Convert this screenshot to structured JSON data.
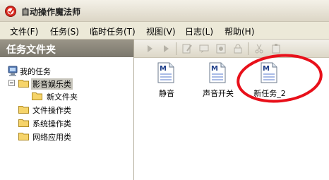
{
  "window": {
    "title": "自动操作魔法师"
  },
  "menu": [
    {
      "label": "文件(F)"
    },
    {
      "label": "任务(S)"
    },
    {
      "label": "临时任务(T)"
    },
    {
      "label": "视图(V)"
    },
    {
      "label": "日志(L)"
    },
    {
      "label": "帮助(H)"
    }
  ],
  "sidebar": {
    "title": "任务文件夹",
    "tree": {
      "root": "我的任务",
      "items": [
        {
          "label": "影音娱乐类",
          "expanded": true,
          "selected": true
        },
        {
          "label": "新文件夹"
        },
        {
          "label": "文件操作类"
        },
        {
          "label": "系统操作类"
        },
        {
          "label": "网络应用类"
        }
      ]
    }
  },
  "files": [
    {
      "label": "静音",
      "icon": "m-document-icon"
    },
    {
      "label": "声音开关",
      "icon": "m-document-icon"
    },
    {
      "label": "新任务_2",
      "icon": "m-document-icon"
    }
  ],
  "colors": {
    "highlight_circle": "#e8101a"
  }
}
